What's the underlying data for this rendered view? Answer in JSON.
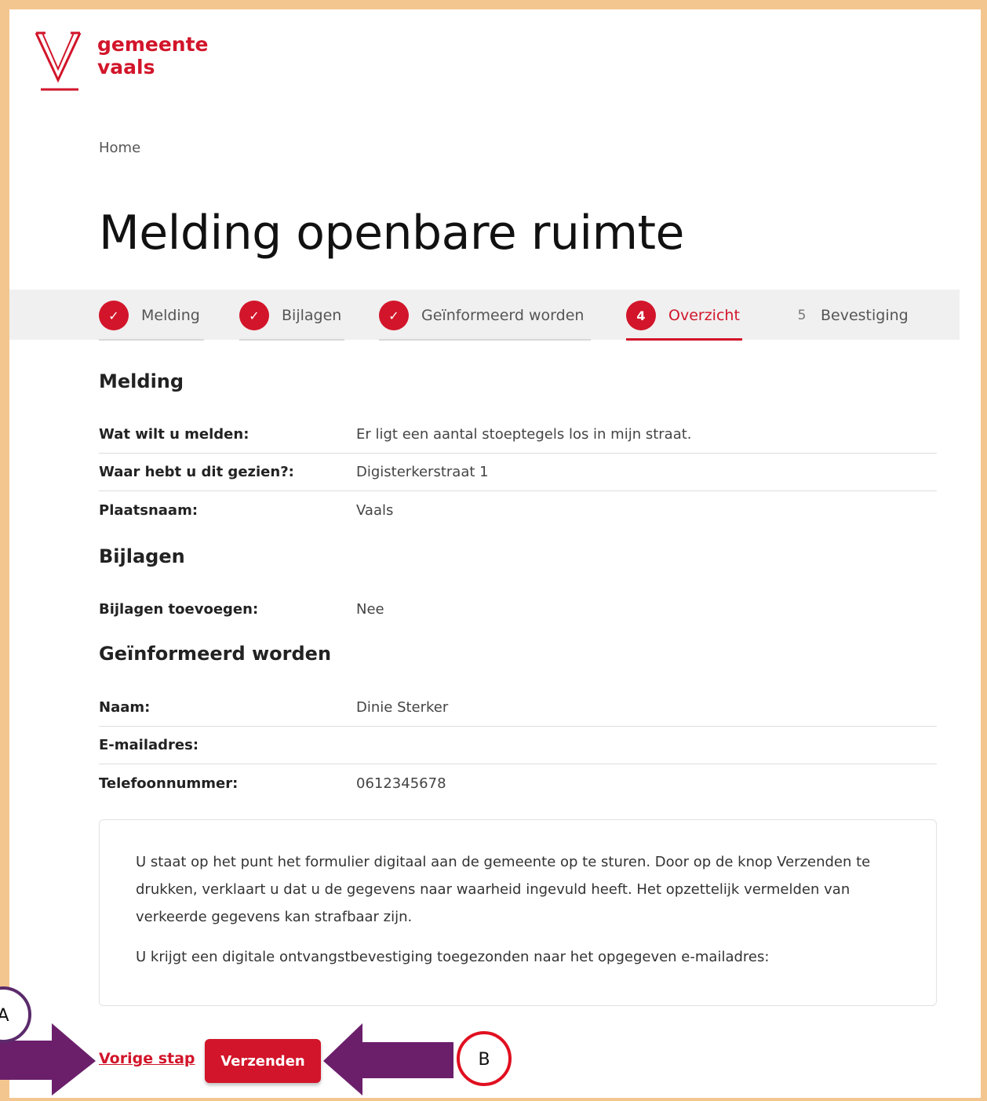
{
  "logo": {
    "line1": "gemeente",
    "line2": "vaals",
    "color": "#d2152a"
  },
  "breadcrumb": {
    "home": "Home"
  },
  "page": {
    "title": "Melding openbare ruimte"
  },
  "stepper": {
    "steps": [
      {
        "label": "Melding",
        "state": "done"
      },
      {
        "label": "Bijlagen",
        "state": "done"
      },
      {
        "label": "Geïnformeerd worden",
        "state": "done"
      },
      {
        "number": "4",
        "label": "Overzicht",
        "state": "active"
      },
      {
        "number": "5",
        "label": "Bevestiging",
        "state": "upcoming"
      }
    ]
  },
  "sections": {
    "melding": {
      "title": "Melding",
      "rows": [
        {
          "label": "Wat wilt u melden:",
          "value": "Er ligt een aantal stoeptegels los in mijn straat."
        },
        {
          "label": "Waar hebt u dit gezien?:",
          "value": "Digisterkerstraat 1"
        },
        {
          "label": "Plaatsnaam:",
          "value": "Vaals"
        }
      ]
    },
    "bijlagen": {
      "title": "Bijlagen",
      "rows": [
        {
          "label": "Bijlagen toevoegen:",
          "value": "Nee"
        }
      ]
    },
    "geinformeerd": {
      "title": "Geïnformeerd worden",
      "rows": [
        {
          "label": "Naam:",
          "value": "Dinie Sterker"
        },
        {
          "label": "E-mailadres:",
          "value": ""
        },
        {
          "label": "Telefoonnummer:",
          "value": "0612345678"
        }
      ]
    }
  },
  "notice": {
    "paragraph1": "U staat op het punt het formulier digitaal aan de gemeente op te sturen. Door op de knop Verzenden te drukken, verklaart u dat u de gegevens naar waarheid ingevuld heeft. Het opzettelijk vermelden van verkeerde gegevens kan strafbaar zijn.",
    "paragraph2": "U krijgt een digitale ontvangstbevestiging toegezonden naar het opgegeven e-mailadres:"
  },
  "actions": {
    "previous": "Vorige stap",
    "submit": "Verzenden"
  },
  "annotations": {
    "a_label": "A",
    "b_label": "B",
    "arrow_color": "#6b1f6b",
    "a_circle_color": "#5b2a6b",
    "b_circle_color": "#e01020"
  }
}
